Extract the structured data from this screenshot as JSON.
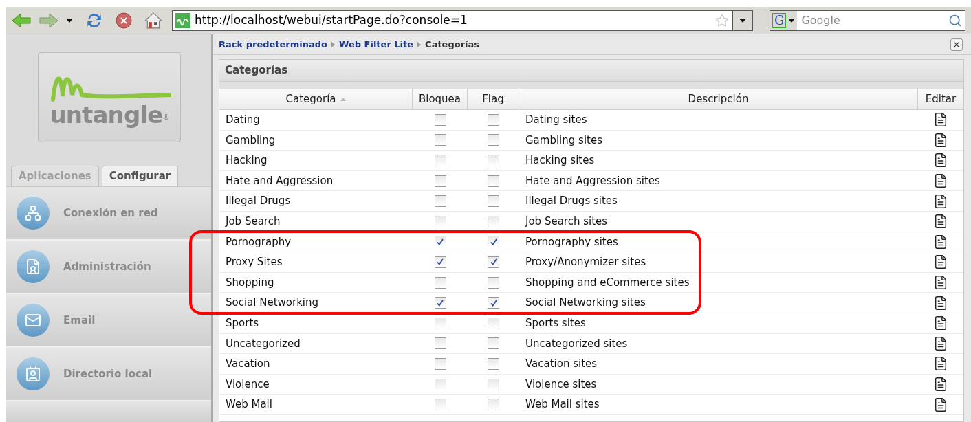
{
  "toolbar": {
    "url": "http://localhost/webui/startPage.do?console=1",
    "search_placeholder": "Google",
    "search_engine_letter": "G"
  },
  "sidebar": {
    "logo_text": "untangle",
    "logo_mark": "®",
    "tabs": [
      {
        "label": "Aplicaciones",
        "selected": false
      },
      {
        "label": "Configurar",
        "selected": true
      }
    ],
    "items": [
      {
        "label": "Conexión en red",
        "kind": "network"
      },
      {
        "label": "Administración",
        "kind": "document"
      },
      {
        "label": "Email",
        "kind": "mail"
      },
      {
        "label": "Directorio local",
        "kind": "contacts"
      }
    ]
  },
  "breadcrumb": [
    "Rack predeterminado",
    "Web Filter Lite",
    "Categorías"
  ],
  "panel": {
    "title": "Categorías",
    "columns": [
      "Categoría",
      "Bloquea",
      "Flag",
      "Descripción",
      "Editar"
    ],
    "rows": [
      {
        "name": "Dating",
        "block": false,
        "flag": false,
        "description": "Dating sites",
        "highlighted": false
      },
      {
        "name": "Gambling",
        "block": false,
        "flag": false,
        "description": "Gambling sites",
        "highlighted": false
      },
      {
        "name": "Hacking",
        "block": false,
        "flag": false,
        "description": "Hacking sites",
        "highlighted": false
      },
      {
        "name": "Hate and Aggression",
        "block": false,
        "flag": false,
        "description": "Hate and Aggression sites",
        "highlighted": false
      },
      {
        "name": "Illegal Drugs",
        "block": false,
        "flag": false,
        "description": "Illegal Drugs sites",
        "highlighted": false
      },
      {
        "name": "Job Search",
        "block": false,
        "flag": false,
        "description": "Job Search sites",
        "highlighted": false
      },
      {
        "name": "Pornography",
        "block": true,
        "flag": true,
        "description": "Pornography sites",
        "highlighted": true
      },
      {
        "name": "Proxy Sites",
        "block": true,
        "flag": true,
        "description": "Proxy/Anonymizer sites",
        "highlighted": true
      },
      {
        "name": "Shopping",
        "block": false,
        "flag": false,
        "description": "Shopping and eCommerce sites",
        "highlighted": true
      },
      {
        "name": "Social Networking",
        "block": true,
        "flag": true,
        "description": "Social Networking sites",
        "highlighted": true
      },
      {
        "name": "Sports",
        "block": false,
        "flag": false,
        "description": "Sports sites",
        "highlighted": false
      },
      {
        "name": "Uncategorized",
        "block": false,
        "flag": false,
        "description": "Uncategorized sites",
        "highlighted": false
      },
      {
        "name": "Vacation",
        "block": false,
        "flag": false,
        "description": "Vacation sites",
        "highlighted": false
      },
      {
        "name": "Violence",
        "block": false,
        "flag": false,
        "description": "Violence sites",
        "highlighted": false
      },
      {
        "name": "Web Mail",
        "block": false,
        "flag": false,
        "description": "Web Mail sites",
        "highlighted": false
      }
    ]
  }
}
